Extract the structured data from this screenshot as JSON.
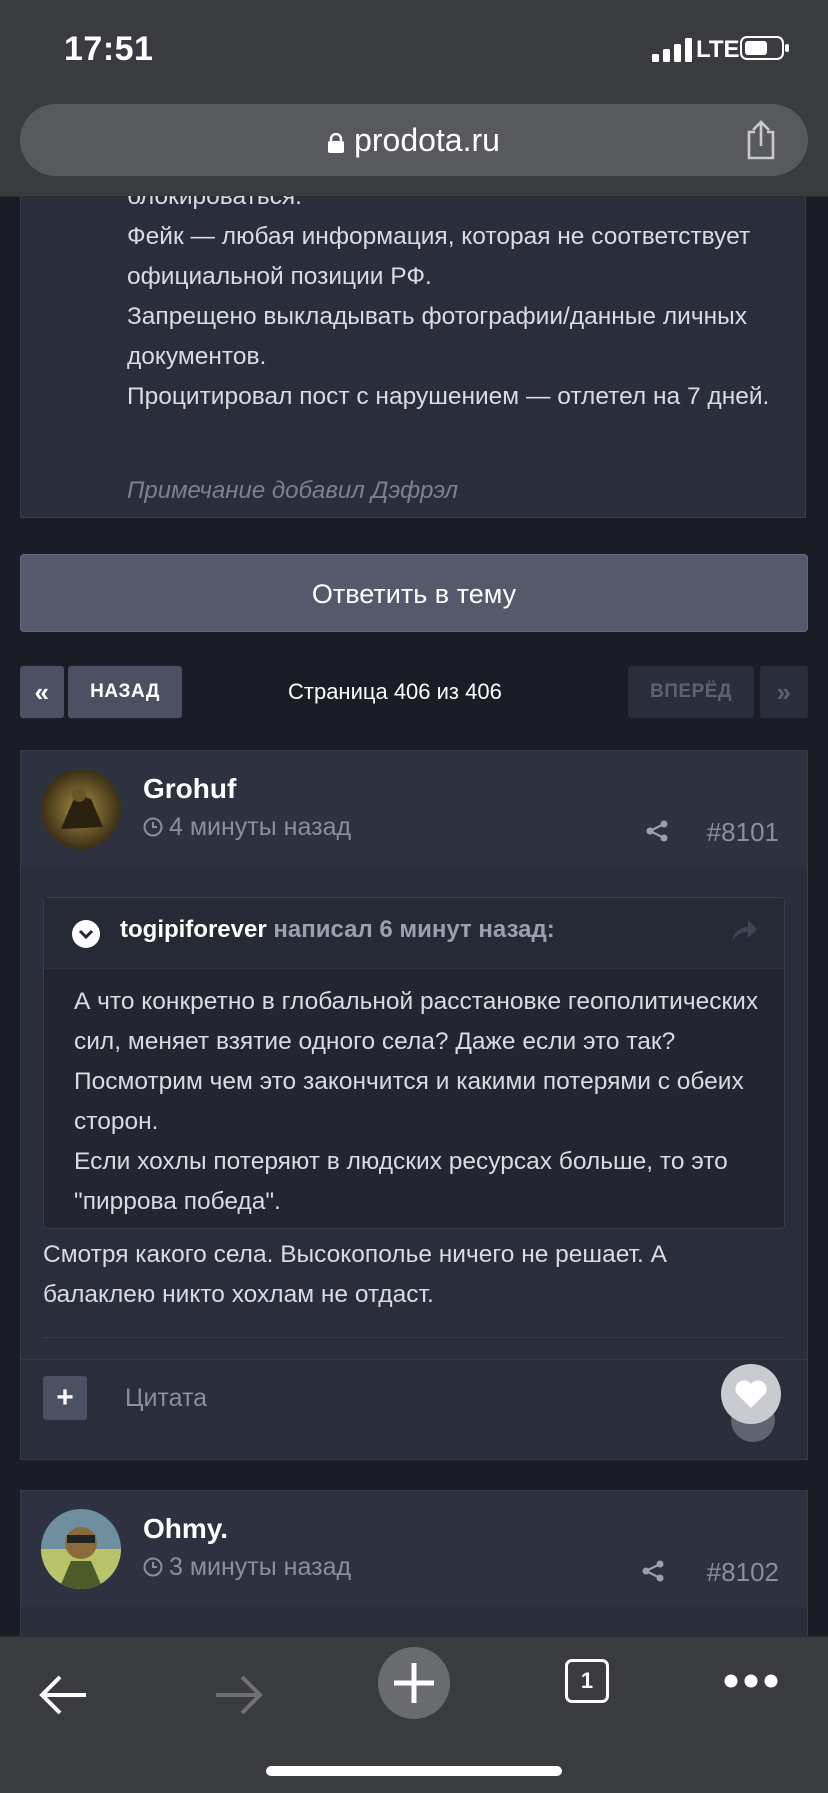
{
  "status": {
    "time": "17:51",
    "network": "LTE"
  },
  "browser": {
    "url": "prodota.ru"
  },
  "notice": {
    "lines": [
      "блокироваться.",
      "Фейк — любая информация, которая не соответствует официальной позиции РФ.",
      "Запрещено выкладывать фотографии/данные личных документов.",
      "Процитировал пост с нарушением — отлетел на 7 дней."
    ],
    "note": "Примечание добавил Дэфрэл"
  },
  "reply_button": "Ответить в тему",
  "pager": {
    "first": "«",
    "prev": "НАЗАД",
    "info": "Страница 406 из 406",
    "next": "ВПЕРЁД",
    "last": "»"
  },
  "posts": [
    {
      "author": "Grohuf",
      "time": "4 минуты назад",
      "number": "#8101",
      "quote": {
        "author": "togipiforever",
        "meta": " написал 6 минут назад:",
        "lines": [
          "А что конкретно в глобальной расстановке геополитических сил, меняет взятие одного села? Даже если это так? Посмотрим чем это закончится и какими потерями с обеих сторон.",
          "Если хохлы потеряют в людских ресурсах больше, то это \"пиррова победа\"."
        ]
      },
      "text": "Смотря какого села. Высокополье ничего не решает. А балаклею никто хохлам не отдаст.",
      "quote_link": "Цитата",
      "plus": "+"
    },
    {
      "author": "Ohmy.",
      "time": "3 минуты назад",
      "number": "#8102"
    }
  ],
  "toolbar": {
    "tabs_count": "1"
  },
  "colors": {
    "background": "#1a1d26",
    "panel": "#2a2e3a",
    "button": "#545a6c",
    "muted": "#8a8f9e"
  }
}
